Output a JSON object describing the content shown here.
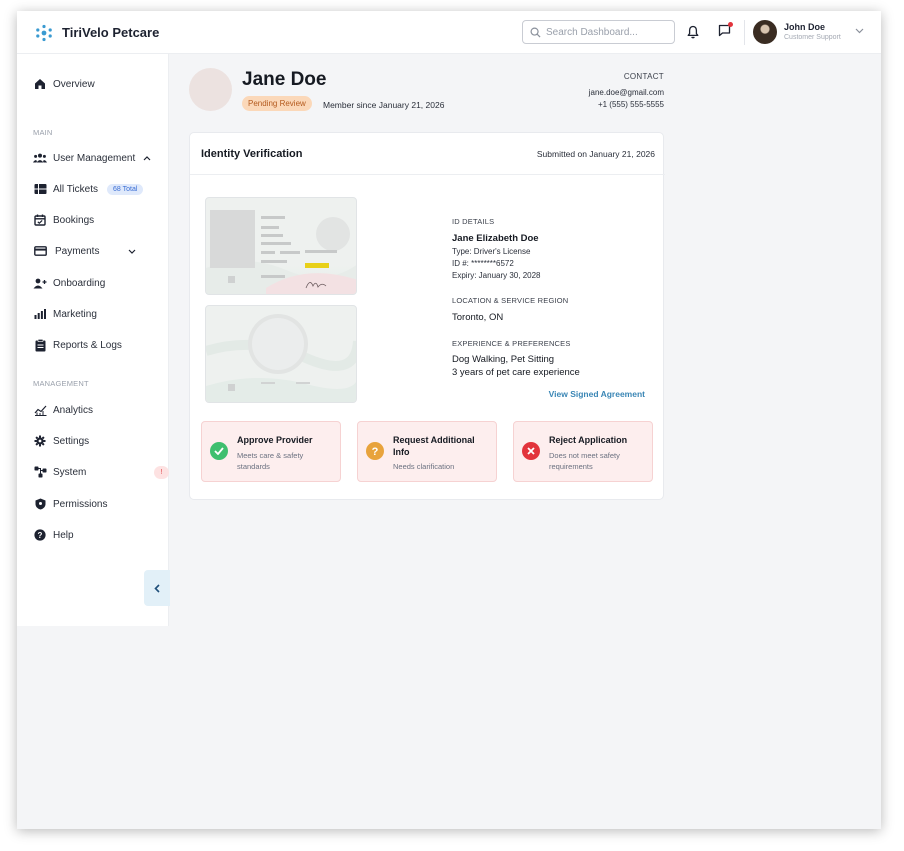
{
  "app": {
    "brand": "TiriVelo Petcare"
  },
  "search": {
    "placeholder": "Search Dashboard..."
  },
  "user": {
    "name": "John Doe",
    "role": "Customer Support"
  },
  "sidebar": {
    "overview": "Overview",
    "section_main": "MAIN",
    "section_management": "MANAGEMENT",
    "items": [
      {
        "label": "User Management",
        "icon": "users-icon"
      },
      {
        "label": "All Tickets",
        "icon": "tickets-icon",
        "badge": "68 Total"
      },
      {
        "label": "Bookings",
        "icon": "calendar-icon"
      },
      {
        "label": "Payments",
        "icon": "card-icon"
      },
      {
        "label": "Onboarding",
        "icon": "user-plus-icon"
      },
      {
        "label": "Marketing",
        "icon": "bar-chart-icon"
      },
      {
        "label": "Reports & Logs",
        "icon": "clipboard-icon"
      }
    ],
    "management": [
      {
        "label": "Analytics",
        "icon": "analytics-icon"
      },
      {
        "label": "Settings",
        "icon": "gear-icon"
      },
      {
        "label": "System",
        "icon": "system-icon",
        "badge": "!"
      },
      {
        "label": "Permissions",
        "icon": "shield-icon"
      },
      {
        "label": "Help",
        "icon": "help-icon"
      }
    ]
  },
  "profile": {
    "name": "Jane Doe",
    "status": "Pending Review",
    "member_since": "Member since January 21, 2026",
    "contact_label": "CONTACT",
    "email": "jane.doe@gmail.com",
    "phone": "+1 (555) 555-5555"
  },
  "verification": {
    "title": "Identity Verification",
    "submitted": "Submitted on January 21, 2026",
    "id_details_label": "ID DETAILS",
    "full_name": "Jane Elizabeth Doe",
    "type": "Type: Driver's License",
    "id_number": "ID #: ********6572",
    "expiry": "Expiry: January 30, 2028",
    "location_label": "LOCATION & SERVICE REGION",
    "location": "Toronto, ON",
    "experience_label": "EXPERIENCE & PREFERENCES",
    "services": "Dog Walking, Pet Sitting",
    "experience": "3 years of pet care experience",
    "agreement_link": "View Signed Agreement"
  },
  "actions": [
    {
      "title": "Approve Provider",
      "desc": "Meets care & safety standards",
      "color": "#3fbf6f"
    },
    {
      "title": "Request Additional Info",
      "desc": "Needs clarification",
      "color": "#e8a33c"
    },
    {
      "title": "Reject Application",
      "desc": "Does not meet safety requirements",
      "color": "#e2343c"
    }
  ]
}
